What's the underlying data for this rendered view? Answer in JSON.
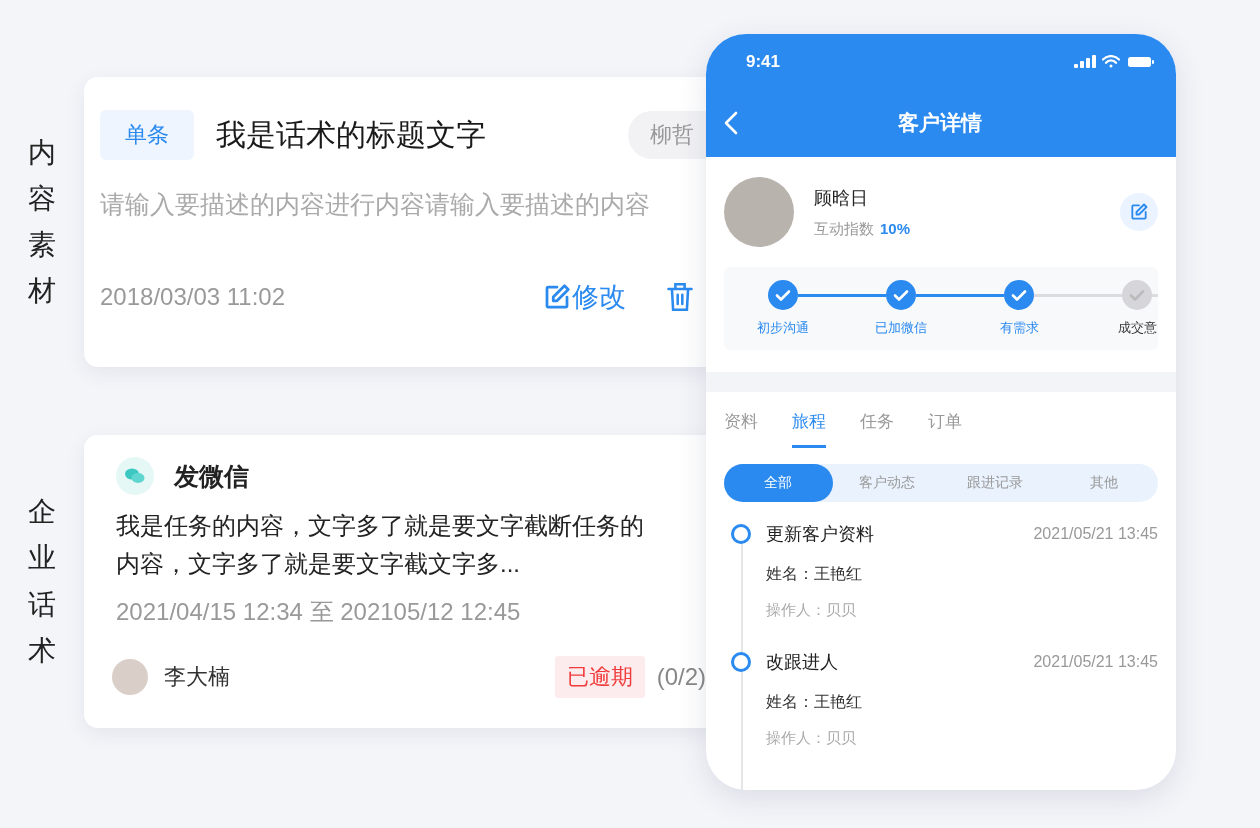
{
  "side_labels": [
    "内容素材",
    "企业话术"
  ],
  "script_card": {
    "tag": "单条",
    "title": "我是话术的标题文字",
    "author": "柳哲",
    "description": "请输入要描述的内容进行内容请输入要描述的内容",
    "date": "2018/03/03 11:02",
    "edit_label": "修改"
  },
  "task_card": {
    "title": "发微信",
    "content": "我是任务的内容，文字多了就是要文字截断任务的内容，文字多了就是要文字截文字多...",
    "period": "2021/04/15 12:34 至 202105/12 12:45",
    "assignee": "李大楠",
    "status": "已逾期",
    "progress": "(0/2)"
  },
  "phone": {
    "status_bar": {
      "time": "9:41"
    },
    "header": {
      "title": "客户详情"
    },
    "customer": {
      "name": "顾晗日",
      "index_label": "互动指数",
      "index_value": "10%"
    },
    "stages": [
      {
        "label": "初步沟通",
        "done": true
      },
      {
        "label": "已加微信",
        "done": true
      },
      {
        "label": "有需求",
        "done": true
      },
      {
        "label": "成交意",
        "done": false
      }
    ],
    "tabs": [
      {
        "label": "资料",
        "selected": false
      },
      {
        "label": "旅程",
        "selected": true
      },
      {
        "label": "任务",
        "selected": false
      },
      {
        "label": "订单",
        "selected": false
      }
    ],
    "filters": [
      {
        "label": "全部",
        "selected": true
      },
      {
        "label": "客户动态",
        "selected": false
      },
      {
        "label": "跟进记录",
        "selected": false
      },
      {
        "label": "其他",
        "selected": false
      }
    ],
    "timeline": [
      {
        "title": "更新客户资料",
        "time": "2021/05/21 13:45",
        "detail": "姓名：王艳红",
        "operator": "操作人：贝贝"
      },
      {
        "title": "改跟进人",
        "time": "2021/05/21 13:45",
        "detail": "姓名：王艳红",
        "operator": "操作人：贝贝"
      }
    ]
  }
}
